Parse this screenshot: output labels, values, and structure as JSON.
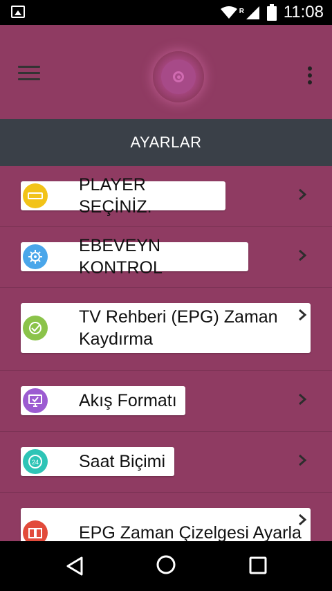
{
  "status_bar": {
    "time": "11:08",
    "roaming": "R"
  },
  "header": {
    "title": "AYARLAR"
  },
  "settings": [
    {
      "label": "PLAYER SEÇİNİZ.",
      "icon": "player-icon",
      "color": "#f2c318"
    },
    {
      "label": "EBEVEYN KONTROL",
      "icon": "gear-icon",
      "color": "#4aa6ea"
    },
    {
      "label": "TV Rehberi (EPG) Zaman Kaydırma",
      "icon": "check-clock-icon",
      "color": "#8bc34a"
    },
    {
      "label": "Akış Formatı",
      "icon": "monitor-icon",
      "color": "#9c5bd1"
    },
    {
      "label": "Saat Biçimi",
      "icon": "clock-24-icon",
      "color": "#2ec4b6"
    },
    {
      "label": "EPG Zaman Çizelgesi Ayarla",
      "icon": "book-icon",
      "color": "#e24b3b"
    }
  ],
  "nav": {
    "back": "back-icon",
    "home": "home-icon",
    "recent": "recent-apps-icon"
  }
}
